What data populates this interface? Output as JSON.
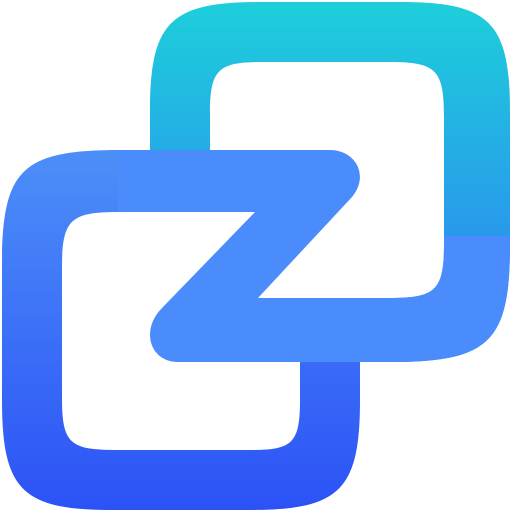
{
  "icon": {
    "name": "link-squares-icon",
    "colors": {
      "back_square_top": "#1dcfda",
      "back_square_bottom": "#2f7cf5",
      "front_square_top": "#4c8ff8",
      "front_square_bottom": "#2c52f6",
      "connector": "#4a8cfb",
      "background": "#ffffff"
    }
  }
}
